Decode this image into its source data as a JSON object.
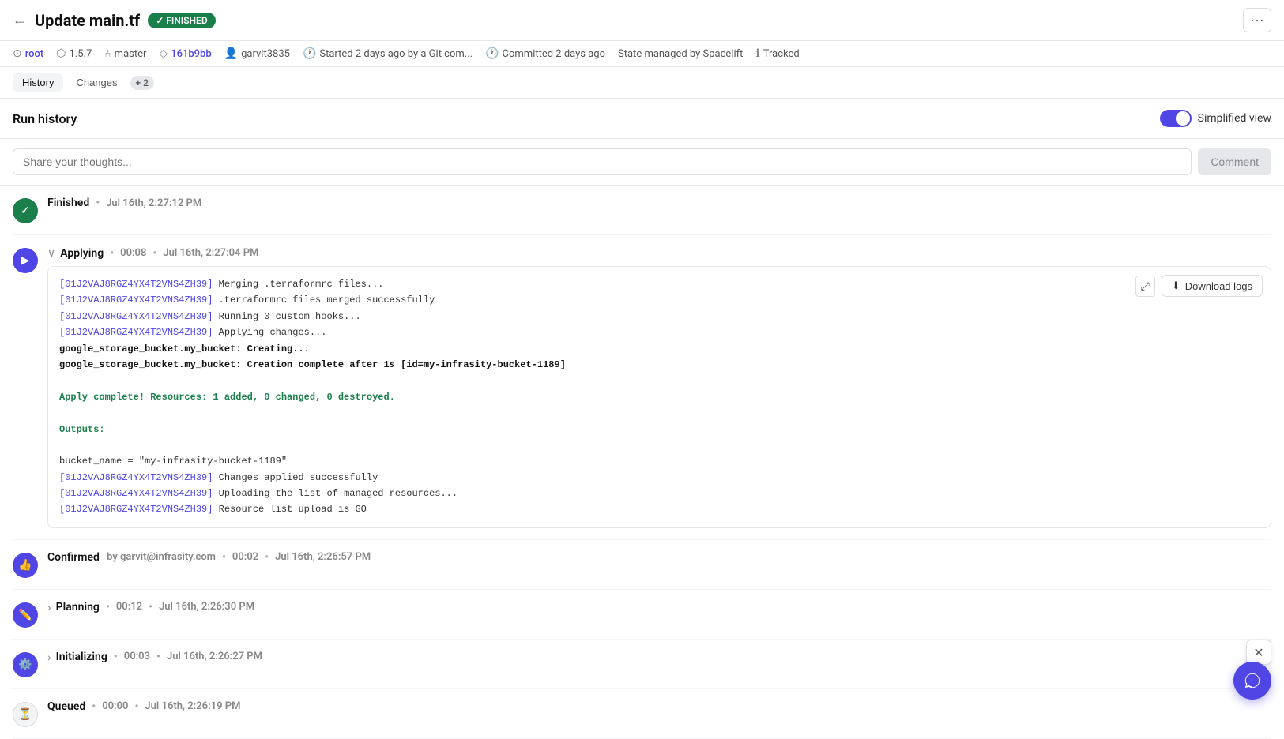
{
  "header": {
    "back_label": "←",
    "title": "Update main.tf",
    "badge_label": "✓ FINISHED",
    "more_label": "···"
  },
  "meta": {
    "root": "root",
    "version": "1.5.7",
    "branch": "master",
    "commit": "161b9bb",
    "user": "garvit3835",
    "started": "Started 2 days ago by a Git com...",
    "committed": "Committed 2 days ago",
    "state": "State managed by Spacelift",
    "tracked": "Tracked"
  },
  "tabs": {
    "history_label": "History",
    "changes_label": "Changes",
    "changes_badge": "+ 2"
  },
  "run_history": {
    "title": "Run history",
    "simplified_view_label": "Simplified view"
  },
  "comment": {
    "placeholder": "Share your thoughts...",
    "button_label": "Comment"
  },
  "timeline": [
    {
      "id": "finished",
      "icon_type": "finished",
      "label": "Finished",
      "timestamp": "Jul 16th, 2:27:12 PM",
      "has_collapse": false,
      "duration": null
    },
    {
      "id": "applying",
      "icon_type": "applying",
      "label": "Applying",
      "duration": "00:08",
      "timestamp": "Jul 16th, 2:27:04 PM",
      "has_collapse": true,
      "collapsed": false,
      "log": {
        "lines": [
          {
            "type": "id-line",
            "id": "[01J2VAJ8RGZ4YX4T2VNS4ZH39]",
            "text": " Merging .terraformrc files..."
          },
          {
            "type": "id-line",
            "id": "[01J2VAJ8RGZ4YX4T2VNS4ZH39]",
            "text": " .terraformrc files merged successfully"
          },
          {
            "type": "id-line",
            "id": "[01J2VAJ8RGZ4YX4T2VNS4ZH39]",
            "text": " Running 0 custom hooks..."
          },
          {
            "type": "id-line",
            "id": "[01J2VAJ8RGZ4YX4T2VNS4ZH39]",
            "text": " Applying changes..."
          },
          {
            "type": "bold",
            "text": "google_storage_bucket.my_bucket: Creating..."
          },
          {
            "type": "bold",
            "text": "google_storage_bucket.my_bucket: Creation complete after 1s [id=my-infrasity-bucket-1189]"
          },
          {
            "type": "blank"
          },
          {
            "type": "green",
            "text": "Apply complete! Resources: 1 added, 0 changed, 0 destroyed."
          },
          {
            "type": "blank"
          },
          {
            "type": "green",
            "text": "Outputs:"
          },
          {
            "type": "blank"
          },
          {
            "type": "plain",
            "text": "bucket_name = \"my-infrasity-bucket-1189\""
          },
          {
            "type": "id-line",
            "id": "[01J2VAJ8RGZ4YX4T2VNS4ZH39]",
            "text": " Changes applied successfully"
          },
          {
            "type": "id-line",
            "id": "[01J2VAJ8RGZ4YX4T2VNS4ZH39]",
            "text": " Uploading the list of managed resources..."
          },
          {
            "type": "id-line",
            "id": "[01J2VAJ8RGZ4YX4T2VNS4ZH39]",
            "text": " Resource list upload is GO"
          }
        ],
        "download_label": "Download logs"
      }
    },
    {
      "id": "confirmed",
      "icon_type": "confirmed",
      "label": "Confirmed",
      "by": "by garvit@infrasity.com",
      "duration": "00:02",
      "timestamp": "Jul 16th, 2:26:57 PM",
      "has_collapse": false
    },
    {
      "id": "planning",
      "icon_type": "planning",
      "label": "Planning",
      "duration": "00:12",
      "timestamp": "Jul 16th, 2:26:30 PM",
      "has_collapse": true,
      "collapsed": true
    },
    {
      "id": "initializing",
      "icon_type": "initializing",
      "label": "Initializing",
      "duration": "00:03",
      "timestamp": "Jul 16th, 2:26:27 PM",
      "has_collapse": true,
      "collapsed": true
    },
    {
      "id": "queued",
      "icon_type": "queued",
      "label": "Queued",
      "duration": "00:00",
      "timestamp": "Jul 16th, 2:26:19 PM",
      "has_collapse": false
    }
  ]
}
